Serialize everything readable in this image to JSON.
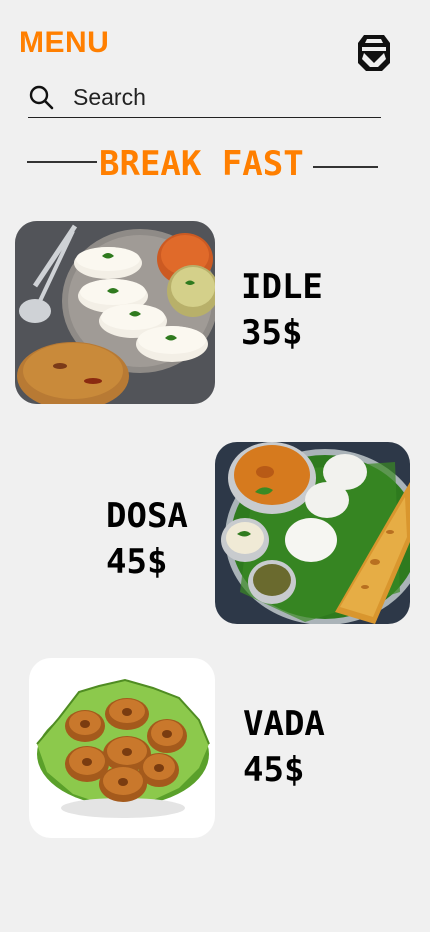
{
  "header": {
    "title": "MENU",
    "logo_icon": "mask-logo-icon"
  },
  "search": {
    "placeholder": "Search",
    "icon": "search-icon"
  },
  "section": {
    "title": "BREAK FAST",
    "accent_color": "#ff7f00"
  },
  "items": [
    {
      "name": "IDLE",
      "price": "35$"
    },
    {
      "name": "DOSA",
      "price": "45$"
    },
    {
      "name": "VADA",
      "price": "45$"
    }
  ]
}
